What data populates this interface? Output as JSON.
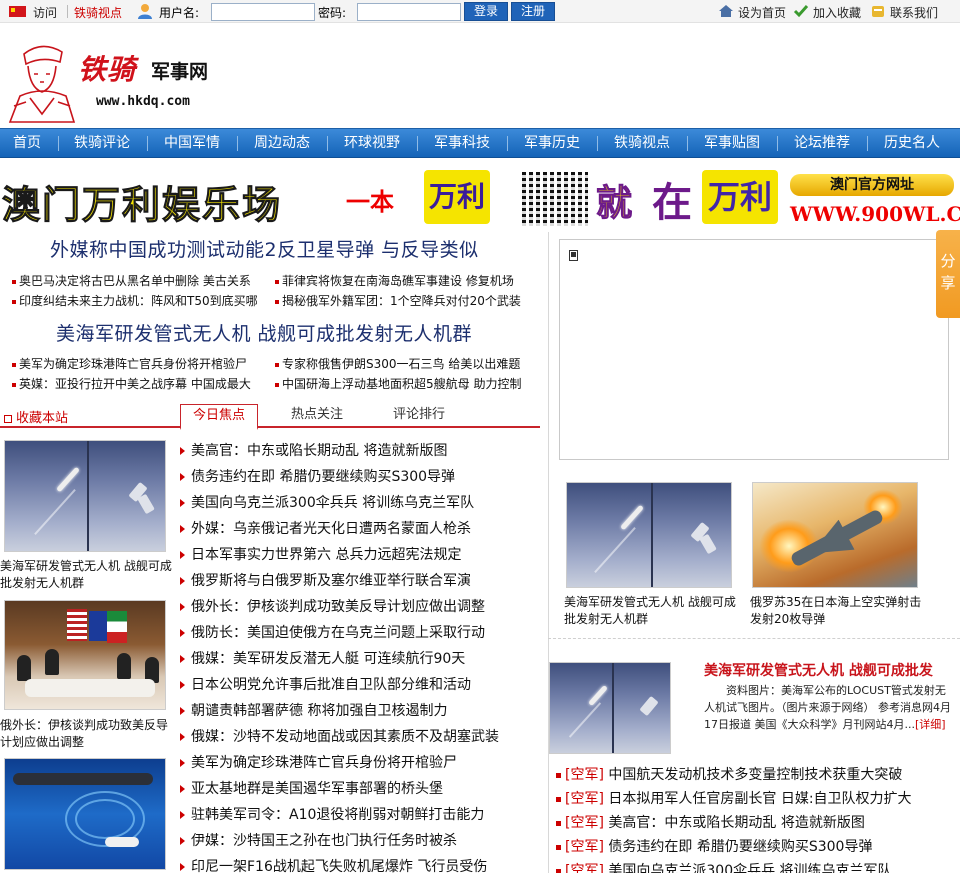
{
  "topbar": {
    "visit": "访问",
    "viewpoint": "铁骑视点",
    "username_label": "用户名:",
    "password_label": "密码:",
    "username_value": "",
    "password_value": "",
    "login": "登录",
    "register": "注册",
    "set_home": "设为首页",
    "add_fav": "加入收藏",
    "contact": "联系我们"
  },
  "header": {
    "brand": "铁骑",
    "brand_sub": "军事网",
    "url": "www.hkdq.com"
  },
  "nav": [
    "首页",
    "铁骑评论",
    "中国军情",
    "周边动态",
    "环球视野",
    "军事科技",
    "军事历史",
    "铁骑视点",
    "军事贴图",
    "论坛推荐",
    "历史名人"
  ],
  "banner": {
    "left_main": "澳门万利娱乐场",
    "left_mid": "一本",
    "left_tail": "万利",
    "right_jiu": "就",
    "right_zai": "在",
    "right_wanli": "万利",
    "official": "澳门官方网址",
    "site": "WWW.900WL.COM"
  },
  "headline1": "外媒称中国成功测试动能2反卫星导弹 与反导类似",
  "sub1": [
    "奥巴马决定将古巴从黑名单中删除 美古关系",
    "菲律宾将恢复在南海岛礁军事建设 修复机场",
    "印度纠结未来主力战机：阵风和T50到底买哪",
    "揭秘俄军外籍军团：1个空降兵对付20个武装"
  ],
  "headline2": "美海军研发管式无人机 战舰可成批发射无人机群",
  "sub2": [
    "美军为确定珍珠港阵亡官兵身份将开棺验尸",
    "专家称俄售伊朗S300一石三鸟 给美以出难题",
    "英媒：亚投行拉开中美之战序幕 中国成最大",
    "中国研海上浮动基地面积超5艘航母 助力控制"
  ],
  "tabs": {
    "favorite": "收藏本站",
    "items": [
      "今日焦点",
      "热点关注",
      "评论排行"
    ]
  },
  "left_photos": [
    {
      "caption": "美海军研发管式无人机 战舰可成批发射无人机群"
    },
    {
      "caption": "俄外长：伊核谈判成功致美反导计划应做出调整"
    },
    {
      "caption": ""
    }
  ],
  "news": [
    "美高官：中东或陷长期动乱 将造就新版图",
    "债务违约在即 希腊仍要继续购买S300导弹",
    "美国向乌克兰派300伞兵兵 将训练乌克兰军队",
    "外媒：乌亲俄记者光天化日遭两名蒙面人枪杀",
    "日本军事实力世界第六 总兵力远超宪法规定",
    "俄罗斯将与白俄罗斯及塞尔维亚举行联合军演",
    "俄外长：伊核谈判成功致美反导计划应做出调整",
    "俄防长：美国迫使俄方在乌克兰问题上采取行动",
    "俄媒：美军研发反潜无人艇 可连续航行90天",
    "日本公明党允许事后批准自卫队部分维和活动",
    "朝谴责韩部署萨德 称将加强自卫核遏制力",
    "俄媒：沙特不发动地面战或因其素质不及胡塞武装",
    "美军为确定珍珠港阵亡官兵身份将开棺验尸",
    "亚太基地群是美国遏华军事部署的桥头堡",
    "驻韩美军司令：A10退役将削弱对朝鲜打击能力",
    "伊媒：沙特国王之孙在也门执行任务时被杀",
    "印尼一架F16战机起飞失败机尾爆炸 飞行员受伤"
  ],
  "share": "分享",
  "right_photos": [
    {
      "caption": "美海军研发管式无人机 战舰可成批发射无人机群"
    },
    {
      "caption": "俄罗苏35在日本海上空实弹射击 发射20枚导弹"
    }
  ],
  "feature": {
    "title": "美海军研发管式无人机 战舰可成批发",
    "body": "资料图片：美海军公布的LOCUST管式发射无人机试飞图片。（图片来源于网络） 参考消息网4月17日报道 美国《大众科学》月刊网站4月...",
    "more": "[详细]"
  },
  "right_list": [
    {
      "tag": "[空军]",
      "text": "中国航天发动机技术多变量控制技术获重大突破"
    },
    {
      "tag": "[空军]",
      "text": "日本拟用军人任官房副长官 日媒:自卫队权力扩大"
    },
    {
      "tag": "[空军]",
      "text": "美高官：中东或陷长期动乱 将造就新版图"
    },
    {
      "tag": "[空军]",
      "text": "债务违约在即 希腊仍要继续购买S300导弹"
    },
    {
      "tag": "[空军]",
      "text": "美国向乌克兰派300伞兵兵 将训练乌克兰军队"
    }
  ]
}
